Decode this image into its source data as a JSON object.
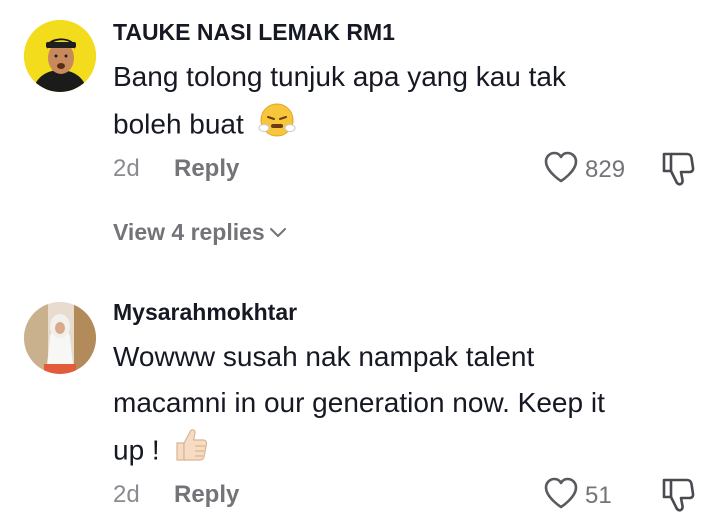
{
  "comments": [
    {
      "username": "TAUKE NASI LEMAK RM1",
      "text_line1": "Bang tolong tunjuk apa yang kau tak",
      "text_line2": "boleh buat",
      "emoji": "steam-face-emoji",
      "age": "2d",
      "reply_label": "Reply",
      "like_count": "829",
      "view_replies_label": "View 4 replies"
    },
    {
      "username": "Mysarahmokhtar",
      "text_line1": "Wowww susah nak nampak talent",
      "text_line2": "macamni in our generation now. Keep it",
      "text_line3": "up !",
      "emoji": "thumbs-up-emoji",
      "age": "2d",
      "reply_label": "Reply",
      "like_count": "51"
    }
  ],
  "icons": {
    "like": "heart-outline-icon",
    "dislike": "thumbs-down-outline-icon",
    "chevron": "chevron-down-icon"
  },
  "colors": {
    "primary_text": "#161823",
    "secondary_text": "#737378",
    "avatar1_bg": "#f2dc1c",
    "emoji_yellow": "#f7c63a"
  }
}
